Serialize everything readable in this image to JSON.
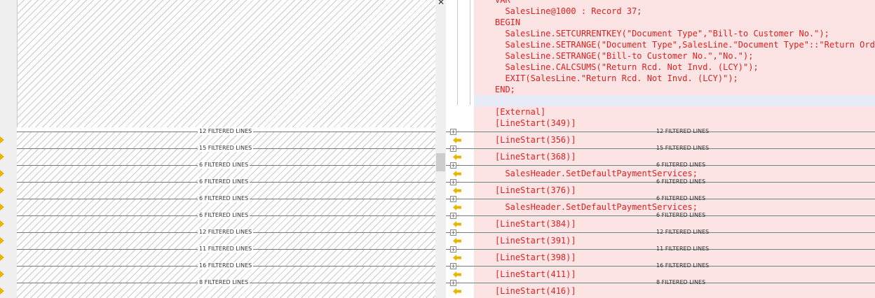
{
  "window": {
    "close_glyph": "✕"
  },
  "code_top": [
    "VAR",
    "  SalesLine@1000 : Record 37;",
    "BEGIN",
    "  SalesLine.SETCURRENTKEY(\"Document Type\",\"Bill-to Customer No.\");",
    "  SalesLine.SETRANGE(\"Document Type\",SalesLine.\"Document Type\"::\"Return Order\");",
    "  SalesLine.SETRANGE(\"Bill-to Customer No.\",\"No.\");",
    "  SalesLine.CALCSUMS(\"Return Rcd. Not Invd. (LCY)\");",
    "  EXIT(SalesLine.\"Return Rcd. Not Invd. (LCY)\");",
    "END;"
  ],
  "code_mid": [
    "[External]",
    "[LineStart(349)]"
  ],
  "left_filtered": [
    "12 FILTERED LINES",
    "15 FILTERED LINES",
    "6 FILTERED LINES",
    "6 FILTERED LINES",
    "6 FILTERED LINES",
    "6 FILTERED LINES",
    "12 FILTERED LINES",
    "11 FILTERED LINES",
    "16 FILTERED LINES",
    "8 FILTERED LINES"
  ],
  "right_filtered": [
    "12 FILTERED LINES",
    "15 FILTERED LINES",
    "6 FILTERED LINES",
    "6 FILTERED LINES",
    "6 FILTERED LINES",
    "6 FILTERED LINES",
    "12 FILTERED LINES",
    "11 FILTERED LINES",
    "16 FILTERED LINES",
    "8 FILTERED LINES"
  ],
  "right_blocks": [
    "[LineStart(356)]",
    "[LineStart(368)]",
    "  SalesHeader.SetDefaultPaymentServices;",
    "[LineStart(376)]",
    "  SalesHeader.SetDefaultPaymentServices;",
    "[LineStart(384)]",
    "[LineStart(391)]",
    "[LineStart(398)]",
    "[LineStart(411)]",
    "[LineStart(416)]"
  ],
  "icons": {
    "left_marker": "arrow-right-icon",
    "right_marker": "arrow-left-icon",
    "expand": "plus-icon"
  },
  "colors": {
    "code": "#e02020",
    "diff_bg": "#fde4e4",
    "marker": "#e8b400"
  }
}
